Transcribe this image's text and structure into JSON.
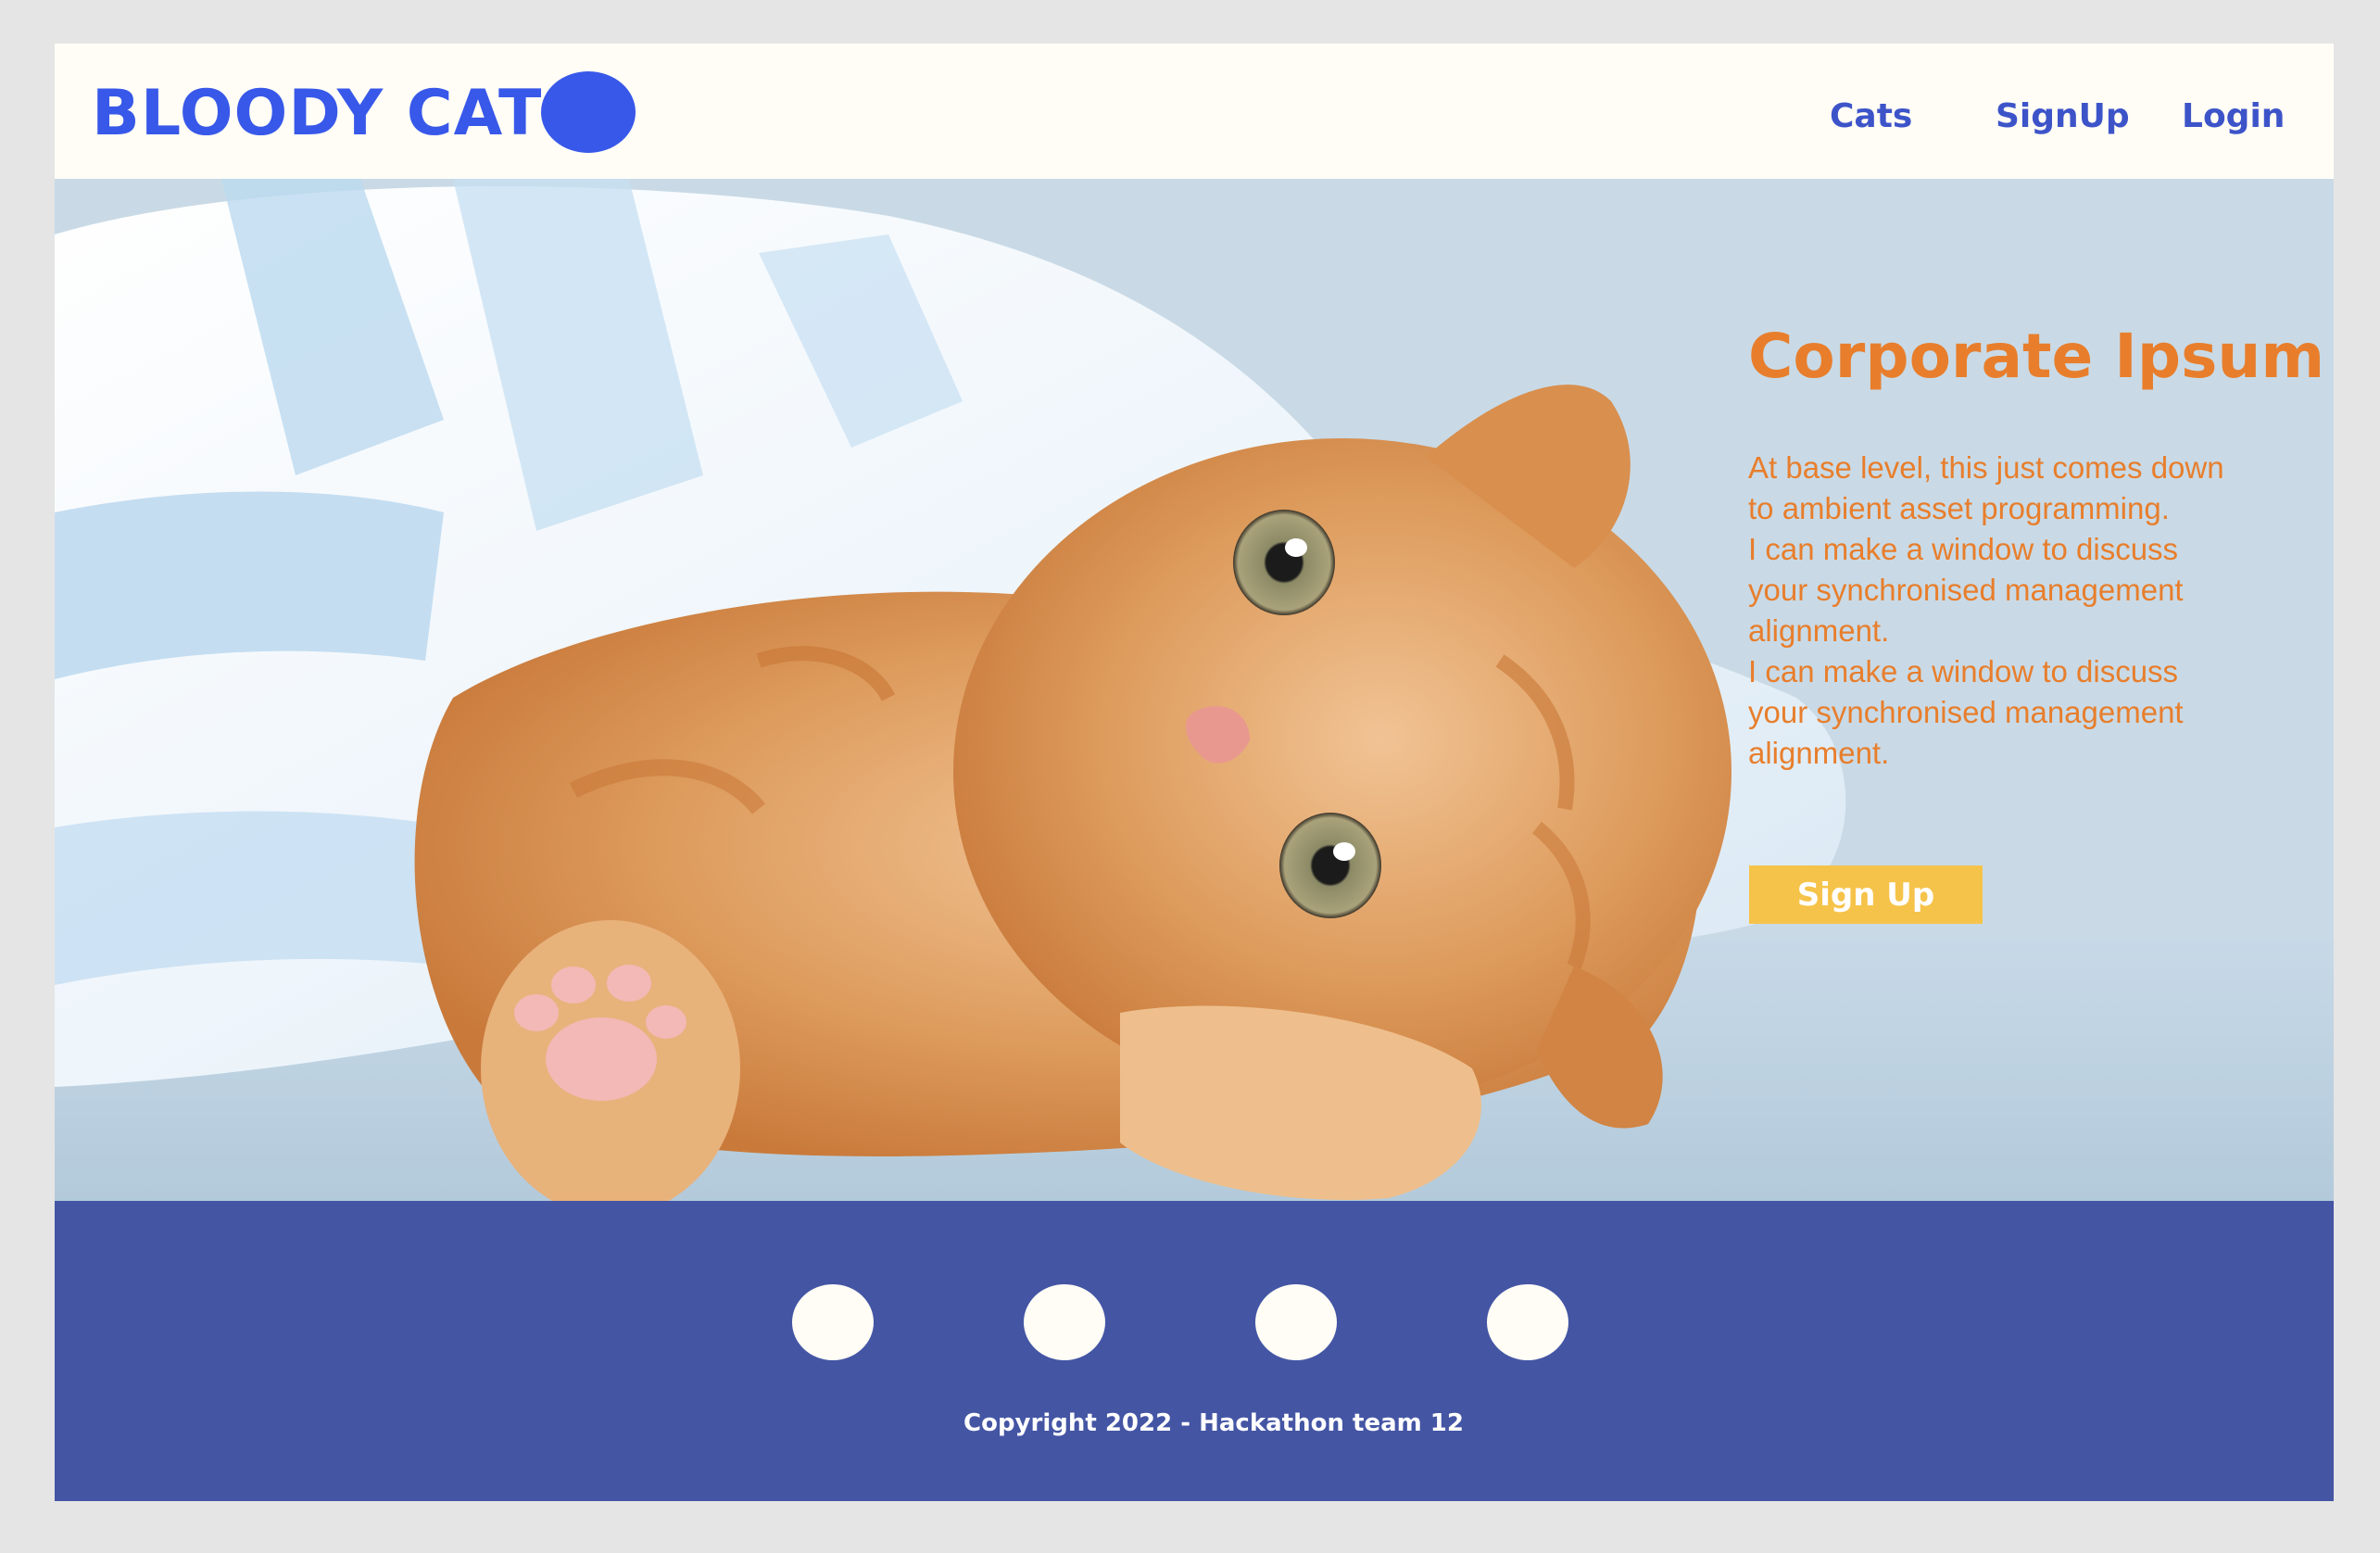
{
  "header": {
    "brand": "BLOODY CAT",
    "nav": [
      "Cats",
      "SignUp",
      "Login"
    ]
  },
  "hero": {
    "title": "Corporate Ipsum",
    "lines": [
      "At base level, this just comes down",
      "to ambient asset programming.",
      "I can make a window to discuss",
      "your synchronised management",
      "alignment.",
      "I can make a window to discuss",
      "your synchronised management",
      "alignment."
    ],
    "cta": "Sign Up",
    "image": "orange-kitten-under-blue-blanket"
  },
  "footer": {
    "social_icons": [
      "social-icon-1",
      "social-icon-2",
      "social-icon-3",
      "social-icon-4"
    ],
    "copyright": "Copyright 2022 - Hackathon team 12"
  },
  "colors": {
    "brand_blue": "#3858e9",
    "nav_blue": "#3d54c9",
    "accent_orange": "#e87e2c",
    "button_yellow": "#f6c34a",
    "footer_blue": "#4455a4",
    "cream": "#fffdf6"
  }
}
